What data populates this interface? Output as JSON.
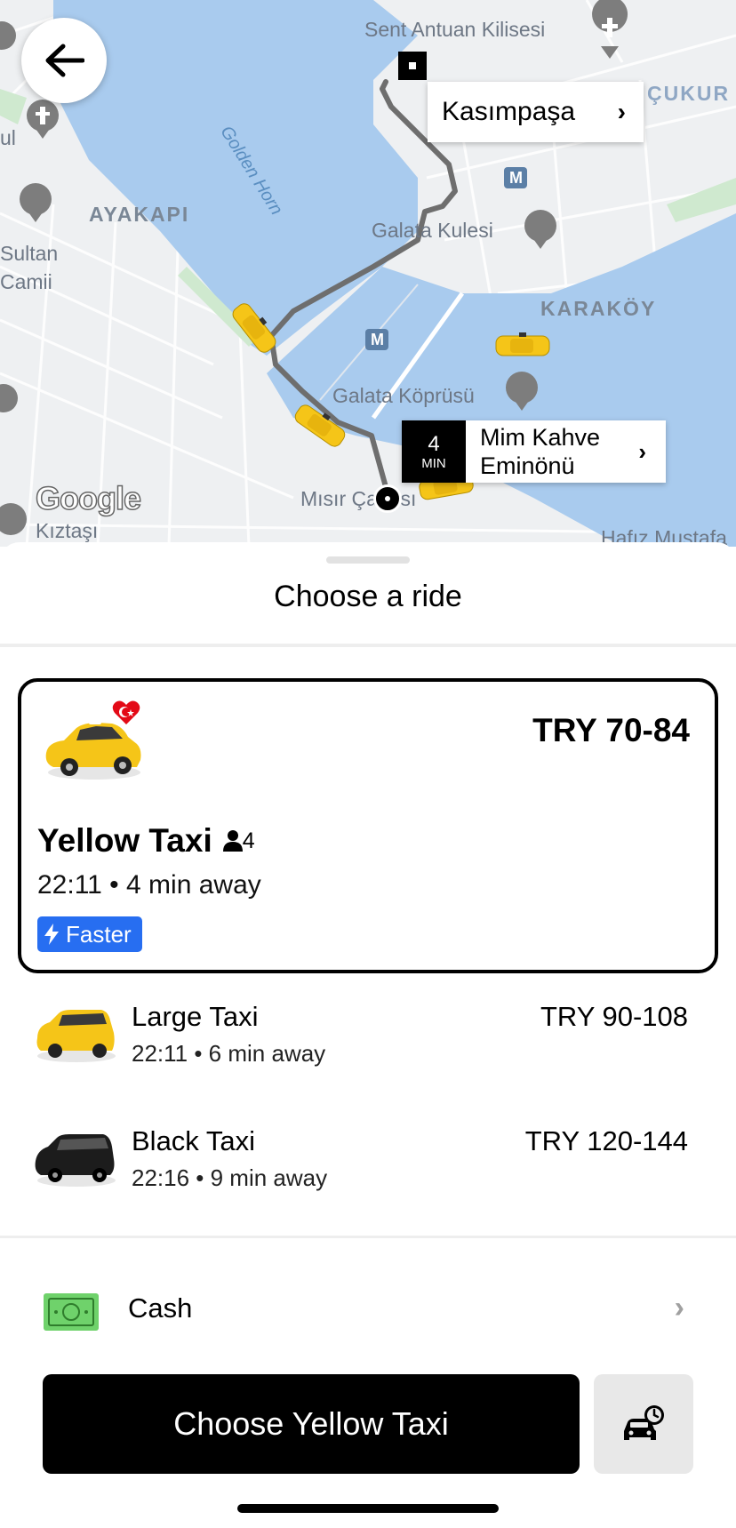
{
  "map": {
    "labels": {
      "sent_antuan": "Sent Antuan Kilisesi",
      "cukur": "ÇUKUR",
      "golden_horn": "Golden Horn",
      "ayakapi": "AYAKAPI",
      "galata_kulesi": "Galata Kulesi",
      "karakoy": "KARAKÖY",
      "galata_koprusu": "Galata Köprüsü",
      "misir_carsisi": "Mısır Çarşısı",
      "sultan": "Sultan",
      "camii": "Camii",
      "ul": "ul",
      "kiztasi": "Kıztaşı",
      "hafiz": "Hafız Mustafa",
      "metro_m": "M"
    },
    "google_logo": "Google",
    "destination": {
      "name": "Kasımpaşa",
      "chevron": "›"
    },
    "pickup": {
      "eta_value": "4",
      "eta_unit": "MIN",
      "line1": "Mim Kahve",
      "line2": "Eminönü",
      "chevron": "›"
    }
  },
  "sheet": {
    "title": "Choose a ride",
    "selected_ride": {
      "name": "Yellow Taxi",
      "seats": "4",
      "price": "TRY 70-84",
      "eta": "22:11 • 4 min away",
      "badge": "Faster"
    },
    "rides": [
      {
        "name": "Large Taxi",
        "eta": "22:11 • 6 min away",
        "price": "TRY 90-108"
      },
      {
        "name": "Black Taxi",
        "eta": "22:16 • 9 min away",
        "price": "TRY 120-144"
      }
    ],
    "payment": {
      "label": "Cash",
      "chevron": "›"
    },
    "cta_label": "Choose Yellow Taxi"
  },
  "colors": {
    "water": "#a9cbee",
    "land": "#eef0f2",
    "park": "#cfe9cf",
    "taxi": "#f5c518",
    "badge_blue": "#276ef1",
    "cash_green": "#6fd26b"
  }
}
